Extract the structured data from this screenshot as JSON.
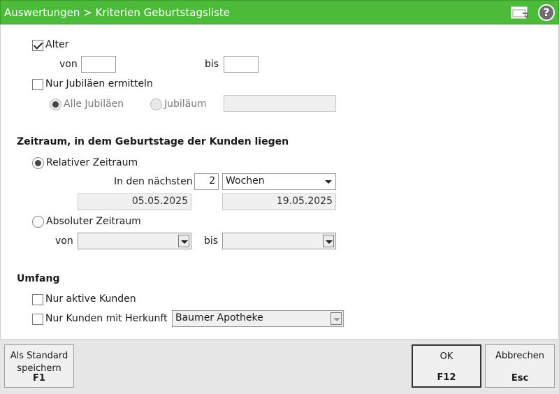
{
  "titlebar": {
    "title": "Auswertungen > Kriterien Geburtstagsliste",
    "help_symbol": "?",
    "icons": [
      "window-icon",
      "help-icon"
    ]
  },
  "age": {
    "checkbox_label": "Alter",
    "checked": true,
    "from_label": "von",
    "from_value": "",
    "to_label": "bis",
    "to_value": ""
  },
  "jubilee": {
    "checkbox_label": "Nur Jubiläen ermitteln",
    "checked": false,
    "all_label": "Alle Jubiläen",
    "single_label": "Jubiläum",
    "single_value": ""
  },
  "period": {
    "section_title": "Zeitraum, in dem Geburtstage der Kunden liegen",
    "relative_label": "Relativer Zeitraum",
    "relative_selected": true,
    "next_label": "In den nächsten",
    "next_value": "2",
    "unit_value": "Wochen",
    "date_from": "05.05.2025",
    "date_to": "19.05.2025",
    "absolute_label": "Absoluter Zeitraum",
    "absolute_selected": false,
    "abs_from_label": "von",
    "abs_from_value": "",
    "abs_to_label": "bis",
    "abs_to_value": ""
  },
  "scope": {
    "section_title": "Umfang",
    "active_label": "Nur aktive Kunden",
    "active_checked": false,
    "origin_label": "Nur Kunden mit Herkunft",
    "origin_checked": false,
    "origin_value": "Baumer Apotheke"
  },
  "footer": {
    "save_default_label": "Als Standard\nspeichern",
    "save_default_key": "F1",
    "ok_label": "OK",
    "ok_key": "F12",
    "cancel_label": "Abbrechen",
    "cancel_key": "Esc"
  },
  "colors": {
    "titlebar": "#4cbb3a",
    "footer": "#e6e6e6"
  }
}
